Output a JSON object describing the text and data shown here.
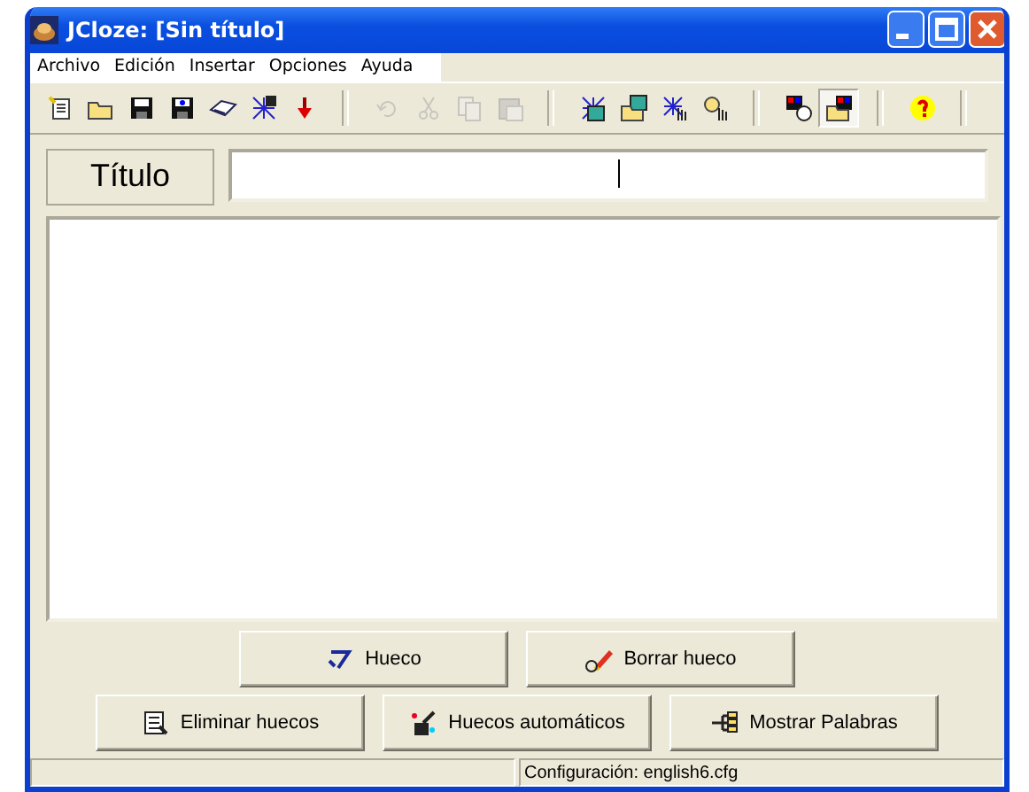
{
  "window": {
    "title": "JCloze: [Sin título]"
  },
  "menu": [
    "Archivo",
    "Edición",
    "Insertar",
    "Opciones",
    "Ayuda"
  ],
  "toolbar": [
    {
      "kind": "button",
      "disabled": false,
      "pressed": false
    },
    {
      "kind": "button",
      "disabled": false,
      "pressed": false
    },
    {
      "kind": "button",
      "disabled": false,
      "pressed": false
    },
    {
      "kind": "button",
      "disabled": false,
      "pressed": false
    },
    {
      "kind": "button",
      "disabled": false,
      "pressed": false
    },
    {
      "kind": "button",
      "disabled": false,
      "pressed": false
    },
    {
      "kind": "button",
      "disabled": false,
      "pressed": false
    },
    {
      "kind": "separator"
    },
    {
      "kind": "button",
      "disabled": true,
      "pressed": false
    },
    {
      "kind": "button",
      "disabled": true,
      "pressed": false
    },
    {
      "kind": "button",
      "disabled": true,
      "pressed": false
    },
    {
      "kind": "button",
      "disabled": true,
      "pressed": false
    },
    {
      "kind": "separator"
    },
    {
      "kind": "button",
      "disabled": false,
      "pressed": false
    },
    {
      "kind": "button",
      "disabled": false,
      "pressed": false
    },
    {
      "kind": "button",
      "disabled": false,
      "pressed": false
    },
    {
      "kind": "button",
      "disabled": false,
      "pressed": false
    },
    {
      "kind": "separator"
    },
    {
      "kind": "button",
      "disabled": false,
      "pressed": false
    },
    {
      "kind": "button",
      "disabled": false,
      "pressed": true
    },
    {
      "kind": "separator"
    },
    {
      "kind": "button",
      "disabled": false,
      "pressed": false
    },
    {
      "kind": "separator"
    }
  ],
  "title_label": "Título",
  "buttons_row_1": [
    "Hueco",
    "Borrar hueco"
  ],
  "buttons_row_2": [
    "Eliminar huecos",
    "Huecos automáticos",
    "Mostrar Palabras"
  ],
  "status_bar": [
    "Configuración: english6.cfg"
  ]
}
